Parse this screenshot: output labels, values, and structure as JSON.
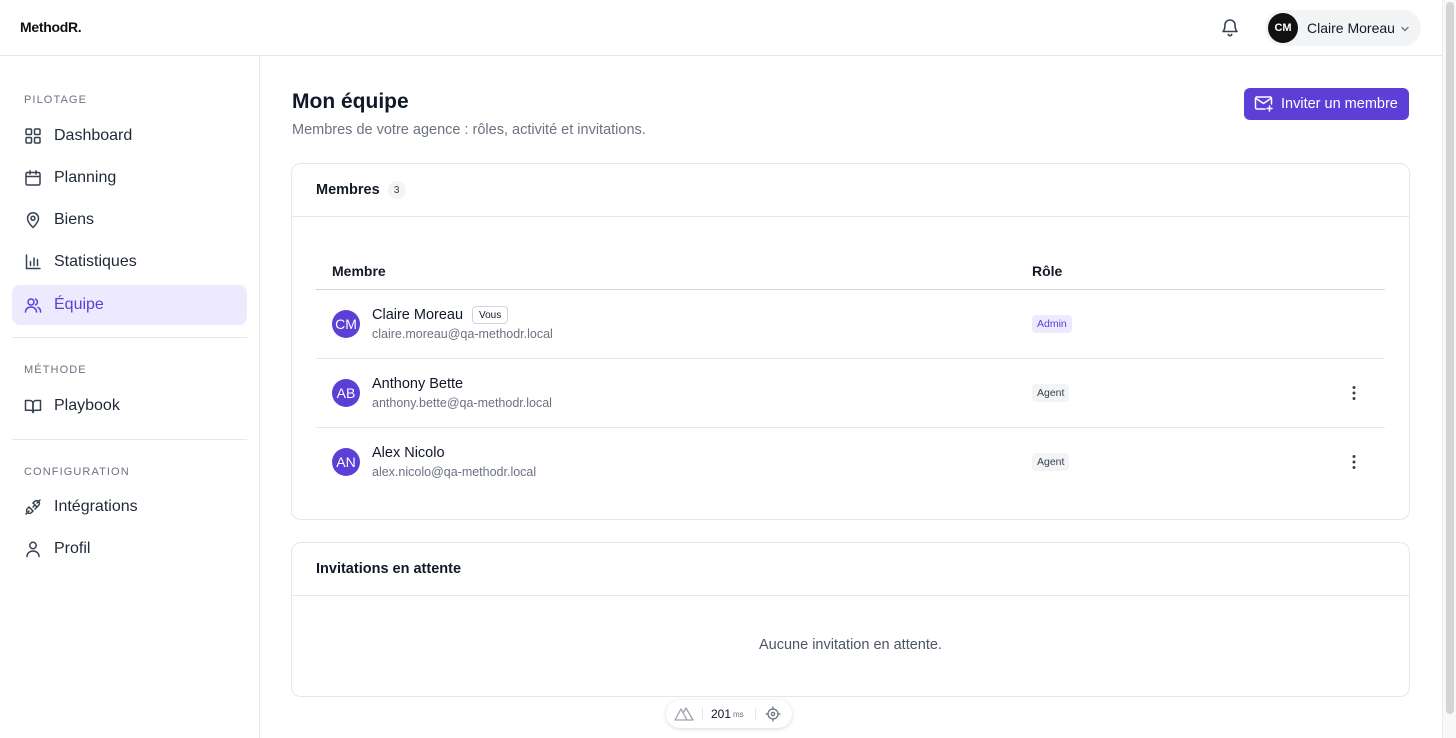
{
  "app": {
    "logo": "MethodR."
  },
  "header": {
    "notifications_icon": "bell-icon",
    "user": {
      "initials": "CM",
      "name": "Claire Moreau"
    }
  },
  "sidebar": {
    "sections": [
      {
        "title": "PILOTAGE"
      },
      {
        "title": "MÉTHODE"
      },
      {
        "title": "CONFIGURATION"
      }
    ],
    "items": [
      {
        "label": "Dashboard",
        "icon": "grid-icon"
      },
      {
        "label": "Planning",
        "icon": "calendar-icon"
      },
      {
        "label": "Biens",
        "icon": "map-pin-icon"
      },
      {
        "label": "Statistiques",
        "icon": "bar-chart-icon"
      },
      {
        "label": "Équipe",
        "icon": "users-icon",
        "active": true
      },
      {
        "label": "Playbook",
        "icon": "book-icon"
      },
      {
        "label": "Intégrations",
        "icon": "plug-icon"
      },
      {
        "label": "Profil",
        "icon": "user-icon"
      }
    ]
  },
  "main": {
    "title": "Mon équipe",
    "subtitle": "Membres de votre agence : rôles, activité et invitations.",
    "invite_button": "Inviter un membre",
    "members": {
      "title": "Membres",
      "count": "3",
      "columns": {
        "member": "Membre",
        "role": "Rôle"
      },
      "rows": [
        {
          "initials": "CM",
          "name": "Claire Moreau",
          "badge": "Vous",
          "email": "claire.moreau@qa-methodr.local",
          "role": "Admin"
        },
        {
          "initials": "AB",
          "name": "Anthony Bette",
          "email": "anthony.bette@qa-methodr.local",
          "role": "Agent"
        },
        {
          "initials": "AN",
          "name": "Alex Nicolo",
          "email": "alex.nicolo@qa-methodr.local",
          "role": "Agent"
        }
      ]
    },
    "invitations": {
      "title": "Invitations en attente",
      "empty": "Aucune invitation en attente."
    }
  },
  "perf": {
    "value": "201",
    "unit": "ms"
  },
  "colors": {
    "accent": "#5b3fd6",
    "accent_soft": "#ede9fe",
    "border": "#e5e7eb",
    "muted": "#6b7280"
  }
}
